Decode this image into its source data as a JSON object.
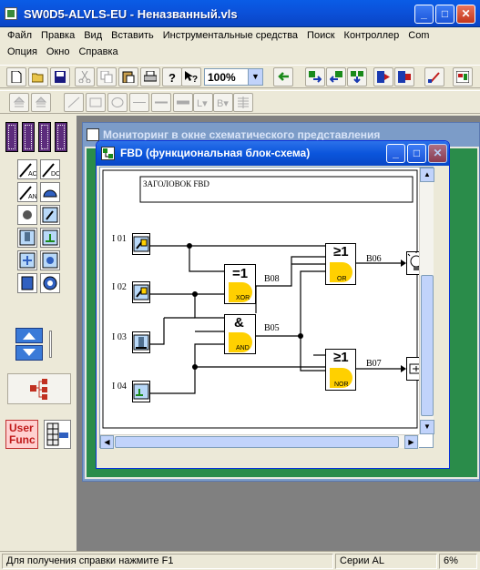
{
  "window": {
    "title": "SW0D5-ALVLS-EU - Неназванный.vls"
  },
  "menu": [
    "Файл",
    "Правка",
    "Вид",
    "Вставить",
    "Инструментальные средства",
    "Поиск",
    "Контроллер",
    "Com"
  ],
  "menu2": [
    "Опция",
    "Окно",
    "Справка"
  ],
  "toolbar": {
    "zoom": "100%"
  },
  "palette": {
    "userfunc_line1": "User",
    "userfunc_line2": "Func"
  },
  "back_window": {
    "title": "Мониторинг в окне схематического представления"
  },
  "fbd_window": {
    "title": "FBD (функциональная блок-схема)",
    "header_box": "ЗАГОЛОВОК FBD",
    "inputs": [
      {
        "id": "I 01",
        "icon": "switch-icon"
      },
      {
        "id": "I 02",
        "icon": "switch-icon"
      },
      {
        "id": "I 03",
        "icon": "sensor-icon"
      },
      {
        "id": "I 04",
        "icon": "selector-icon"
      }
    ],
    "blocks": [
      {
        "id": "B08",
        "symbol": "=1",
        "gate": "XOR"
      },
      {
        "id": "B05",
        "symbol": "&",
        "gate": "AND"
      },
      {
        "id": "B06",
        "symbol": "≥1",
        "gate": "OR"
      },
      {
        "id": "B07",
        "symbol": "≥1",
        "gate": "NOR"
      }
    ],
    "outputs": [
      {
        "icon": "lamp-icon"
      },
      {
        "icon": "motor-icon"
      }
    ]
  },
  "status": {
    "help": "Для получения справки нажмите F1",
    "series": "Серии AL",
    "percent": "6%"
  }
}
